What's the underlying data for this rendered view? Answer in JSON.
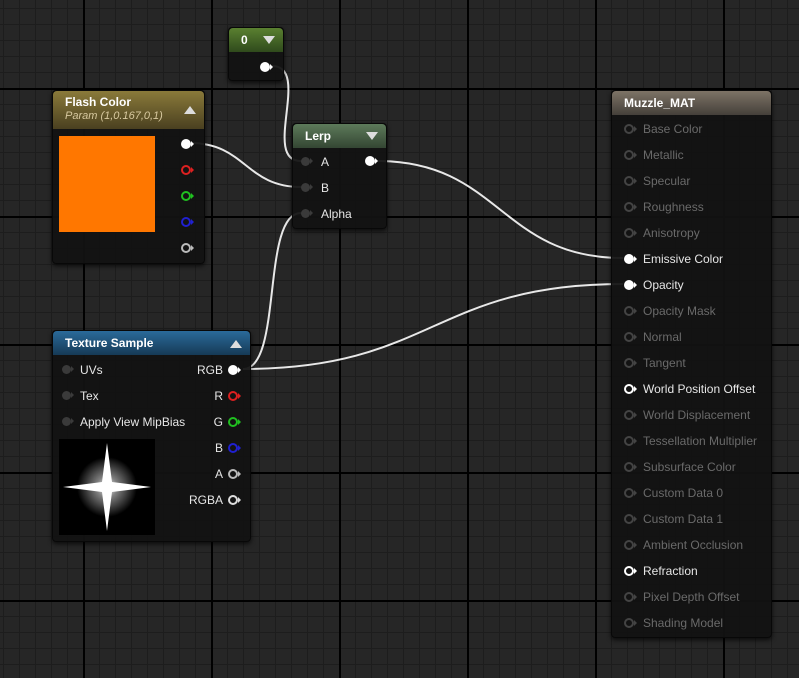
{
  "flash_color_node": {
    "title": "Flash Color",
    "subtitle": "Param (1,0.167,0,1)",
    "swatch_color": "#ff7700",
    "output_pins": [
      {
        "color": "#ffffff",
        "style": "filled"
      },
      {
        "color": "#dd2020",
        "style": "hollow"
      },
      {
        "color": "#20c020",
        "style": "hollow"
      },
      {
        "color": "#2020d0",
        "style": "hollow"
      },
      {
        "color": "#bbbbbb",
        "style": "hollow"
      }
    ]
  },
  "constant_node": {
    "title": "0"
  },
  "lerp_node": {
    "title": "Lerp",
    "inputs": [
      "A",
      "B",
      "Alpha"
    ]
  },
  "texture_node": {
    "title": "Texture Sample",
    "inputs": [
      "UVs",
      "Tex",
      "Apply View MipBias"
    ],
    "outputs": [
      "RGB",
      "R",
      "G",
      "B",
      "A",
      "RGBA"
    ],
    "preview": "star-flare-texture"
  },
  "material_node": {
    "title": "Muzzle_MAT",
    "inputs": [
      {
        "label": "Base Color",
        "active": false
      },
      {
        "label": "Metallic",
        "active": false
      },
      {
        "label": "Specular",
        "active": false
      },
      {
        "label": "Roughness",
        "active": false
      },
      {
        "label": "Anisotropy",
        "active": false
      },
      {
        "label": "Emissive Color",
        "active": true,
        "connected": true
      },
      {
        "label": "Opacity",
        "active": true,
        "connected": true
      },
      {
        "label": "Opacity Mask",
        "active": false
      },
      {
        "label": "Normal",
        "active": false
      },
      {
        "label": "Tangent",
        "active": false
      },
      {
        "label": "World Position Offset",
        "active": true,
        "connected": false
      },
      {
        "label": "World Displacement",
        "active": false
      },
      {
        "label": "Tessellation Multiplier",
        "active": false
      },
      {
        "label": "Subsurface Color",
        "active": false
      },
      {
        "label": "Custom Data 0",
        "active": false
      },
      {
        "label": "Custom Data 1",
        "active": false
      },
      {
        "label": "Ambient Occlusion",
        "active": false
      },
      {
        "label": "Refraction",
        "active": true,
        "connected": false
      },
      {
        "label": "Pixel Depth Offset",
        "active": false
      },
      {
        "label": "Shading Model",
        "active": false
      }
    ]
  },
  "colors": {
    "flash_header": "#8a7a3a",
    "constant_header": "#5a8030",
    "lerp_header": "#5d7a5a",
    "texture_header": "#2a6a9a",
    "material_header": "#7d7366",
    "wire": "#e8e8e8"
  }
}
